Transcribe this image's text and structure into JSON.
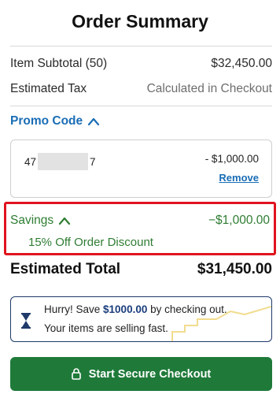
{
  "title": "Order Summary",
  "lines": {
    "subtotal_label": "Item Subtotal (50)",
    "subtotal_value": "$32,450.00",
    "tax_label": "Estimated Tax",
    "tax_value": "Calculated in Checkout"
  },
  "promo": {
    "toggle_label": "Promo Code",
    "code_prefix": "47",
    "code_suffix": "7",
    "amount": "- $1,000.00",
    "remove_label": "Remove"
  },
  "savings": {
    "label": "Savings",
    "amount": "−$1,000.00",
    "detail": "15% Off Order Discount"
  },
  "total": {
    "label": "Estimated Total",
    "value": "$31,450.00"
  },
  "hurry": {
    "line1_pre": "Hurry! Save ",
    "line1_amount": "$1000.00",
    "line1_post": " by checking out.",
    "line2": "Your items are selling fast."
  },
  "checkout": {
    "label": "Start Secure Checkout"
  },
  "colors": {
    "accent_blue": "#1a6db5",
    "savings_green": "#2e7d32",
    "highlight_red": "#e0141f",
    "button_green": "#1f7a3a",
    "hurry_border": "#1f3a6b"
  },
  "icons": {
    "promo_toggle": "chevron-up-icon",
    "savings_toggle": "chevron-up-icon",
    "hurry": "hourglass-icon",
    "checkout": "lock-icon"
  }
}
